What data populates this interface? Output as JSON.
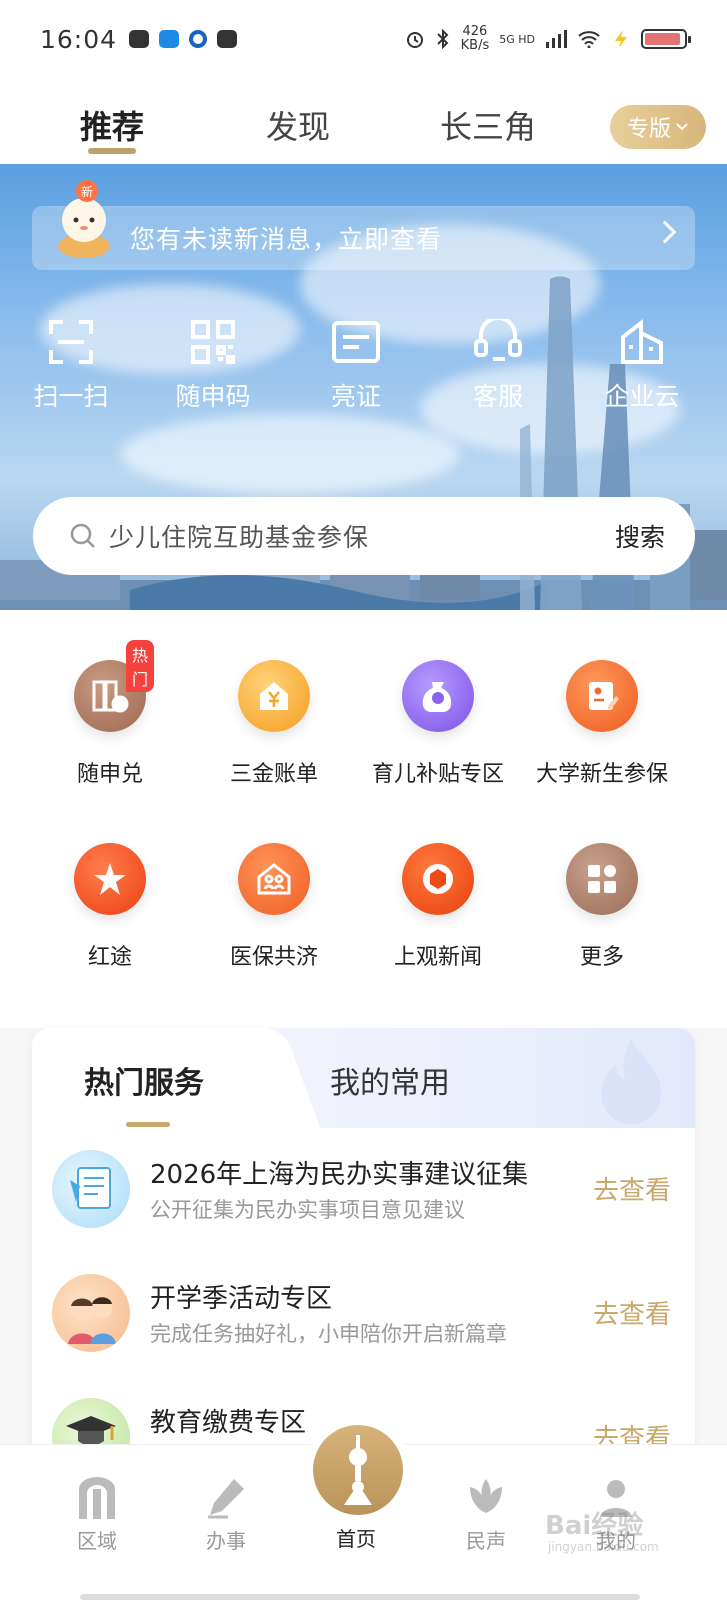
{
  "status_bar": {
    "time": "16:04",
    "net_speed_value": "426",
    "net_speed_unit": "KB/s",
    "signal_label": "5G HD"
  },
  "top_tabs": {
    "tabs": [
      "推荐",
      "发现",
      "长三角"
    ],
    "active_index": 0,
    "edition_label": "专版"
  },
  "notice": {
    "badge": "新",
    "text": "您有未读新消息，立即查看"
  },
  "quick_actions": [
    {
      "label": "扫一扫",
      "icon": "scan-icon"
    },
    {
      "label": "随申码",
      "icon": "qr-code-icon"
    },
    {
      "label": "亮证",
      "icon": "id-card-icon"
    },
    {
      "label": "客服",
      "icon": "headset-icon"
    },
    {
      "label": "企业云",
      "icon": "building-icon"
    }
  ],
  "search": {
    "placeholder": "少儿住院互助基金参保",
    "button": "搜索"
  },
  "services": [
    {
      "label": "随申兑",
      "icon": "voucher-icon",
      "tag": "热门",
      "color": "#a5705a"
    },
    {
      "label": "三金账单",
      "icon": "house-yuan-icon",
      "color": "#f5a623"
    },
    {
      "label": "育儿补贴专区",
      "icon": "money-bag-icon",
      "color": "#8a63e8"
    },
    {
      "label": "大学新生参保",
      "icon": "edit-card-icon",
      "color": "#f06a2e"
    },
    {
      "label": "红途",
      "icon": "star-icon",
      "color": "#f0461e"
    },
    {
      "label": "医保共济",
      "icon": "family-icon",
      "color": "#f36a2a"
    },
    {
      "label": "上观新闻",
      "icon": "aperture-icon",
      "color": "#f04a14"
    },
    {
      "label": "更多",
      "icon": "grid-more-icon",
      "color": "#a47a62"
    }
  ],
  "hot_card": {
    "tabs": [
      "热门服务",
      "我的常用"
    ],
    "items": [
      {
        "title": "2026年上海为民办实事建议征集",
        "subtitle": "公开征集为民办实事项目意见建议",
        "action": "去查看"
      },
      {
        "title": "开学季活动专区",
        "subtitle": "完成任务抽好礼，小申陪你开启新篇章",
        "action": "去查看"
      },
      {
        "title": "教育缴费专区",
        "subtitle": "",
        "action": "去查看"
      }
    ]
  },
  "bottom_nav": {
    "items": [
      "区域",
      "办事",
      "首页",
      "民声",
      "我的"
    ],
    "active_index": 2
  },
  "watermark": {
    "brand": "Bai经验",
    "url": "jingyan.baidu.com"
  }
}
